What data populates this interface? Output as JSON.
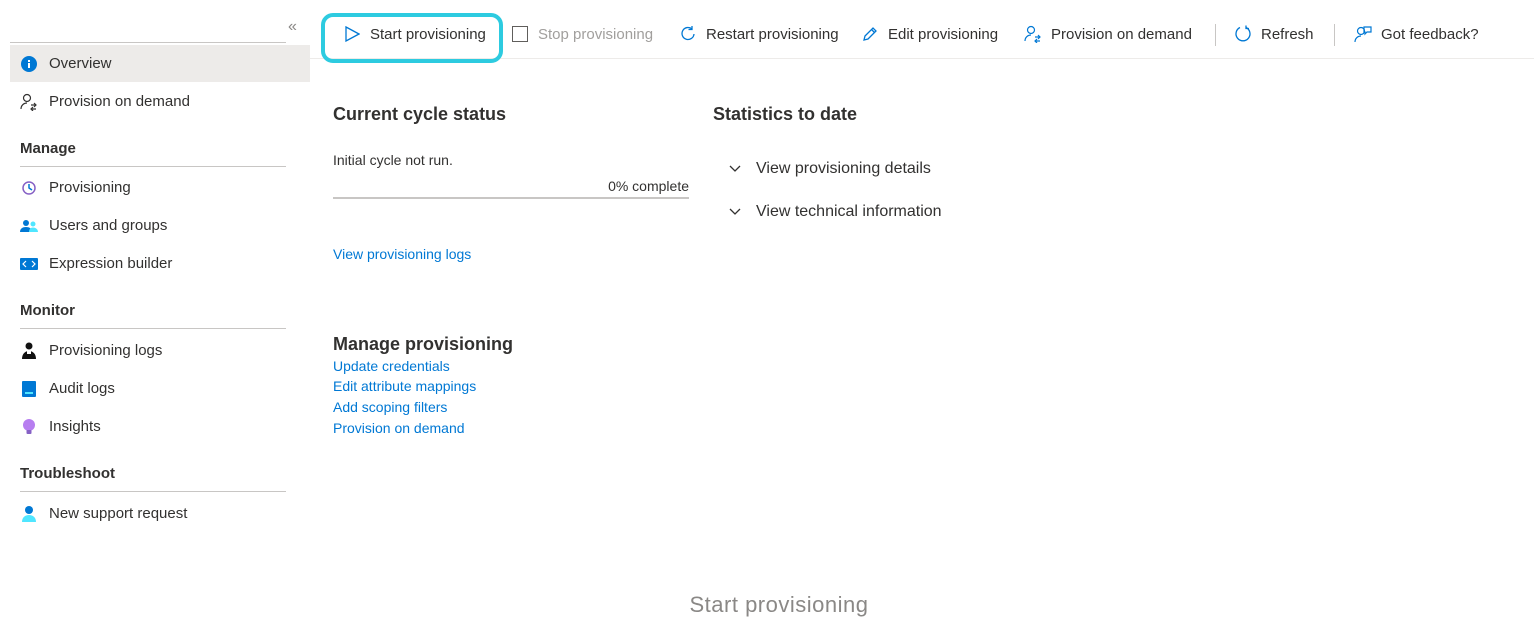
{
  "sidebar": {
    "collapse": "«",
    "top_items": [
      {
        "label": "Overview",
        "icon": "info-icon"
      },
      {
        "label": "Provision on demand",
        "icon": "provision-demand-icon"
      }
    ],
    "sections": [
      {
        "title": "Manage",
        "items": [
          {
            "label": "Provisioning",
            "icon": "provisioning-icon"
          },
          {
            "label": "Users and groups",
            "icon": "users-groups-icon"
          },
          {
            "label": "Expression builder",
            "icon": "expression-builder-icon"
          }
        ]
      },
      {
        "title": "Monitor",
        "items": [
          {
            "label": "Provisioning logs",
            "icon": "person-logs-icon"
          },
          {
            "label": "Audit logs",
            "icon": "audit-logs-icon"
          },
          {
            "label": "Insights",
            "icon": "lightbulb-icon"
          }
        ]
      },
      {
        "title": "Troubleshoot",
        "items": [
          {
            "label": "New support request",
            "icon": "support-person-icon"
          }
        ]
      }
    ]
  },
  "toolbar": {
    "start": "Start provisioning",
    "stop": "Stop provisioning",
    "restart": "Restart provisioning",
    "edit": "Edit provisioning",
    "on_demand": "Provision on demand",
    "refresh": "Refresh",
    "feedback": "Got feedback?"
  },
  "status": {
    "heading": "Current cycle status",
    "message": "Initial cycle not run.",
    "progress_label": "0% complete",
    "progress_fraction": 0,
    "logs_link": "View provisioning logs"
  },
  "stats": {
    "heading": "Statistics to date",
    "details": "View provisioning details",
    "technical": "View technical information"
  },
  "manage": {
    "heading": "Manage provisioning",
    "links": [
      "Update credentials",
      "Edit attribute mappings",
      "Add scoping filters",
      "Provision on demand"
    ]
  },
  "caption": "Start provisioning",
  "colors": {
    "accent": "#0078d4",
    "highlight": "#2dcbe0",
    "active_bg": "#edebe9"
  }
}
